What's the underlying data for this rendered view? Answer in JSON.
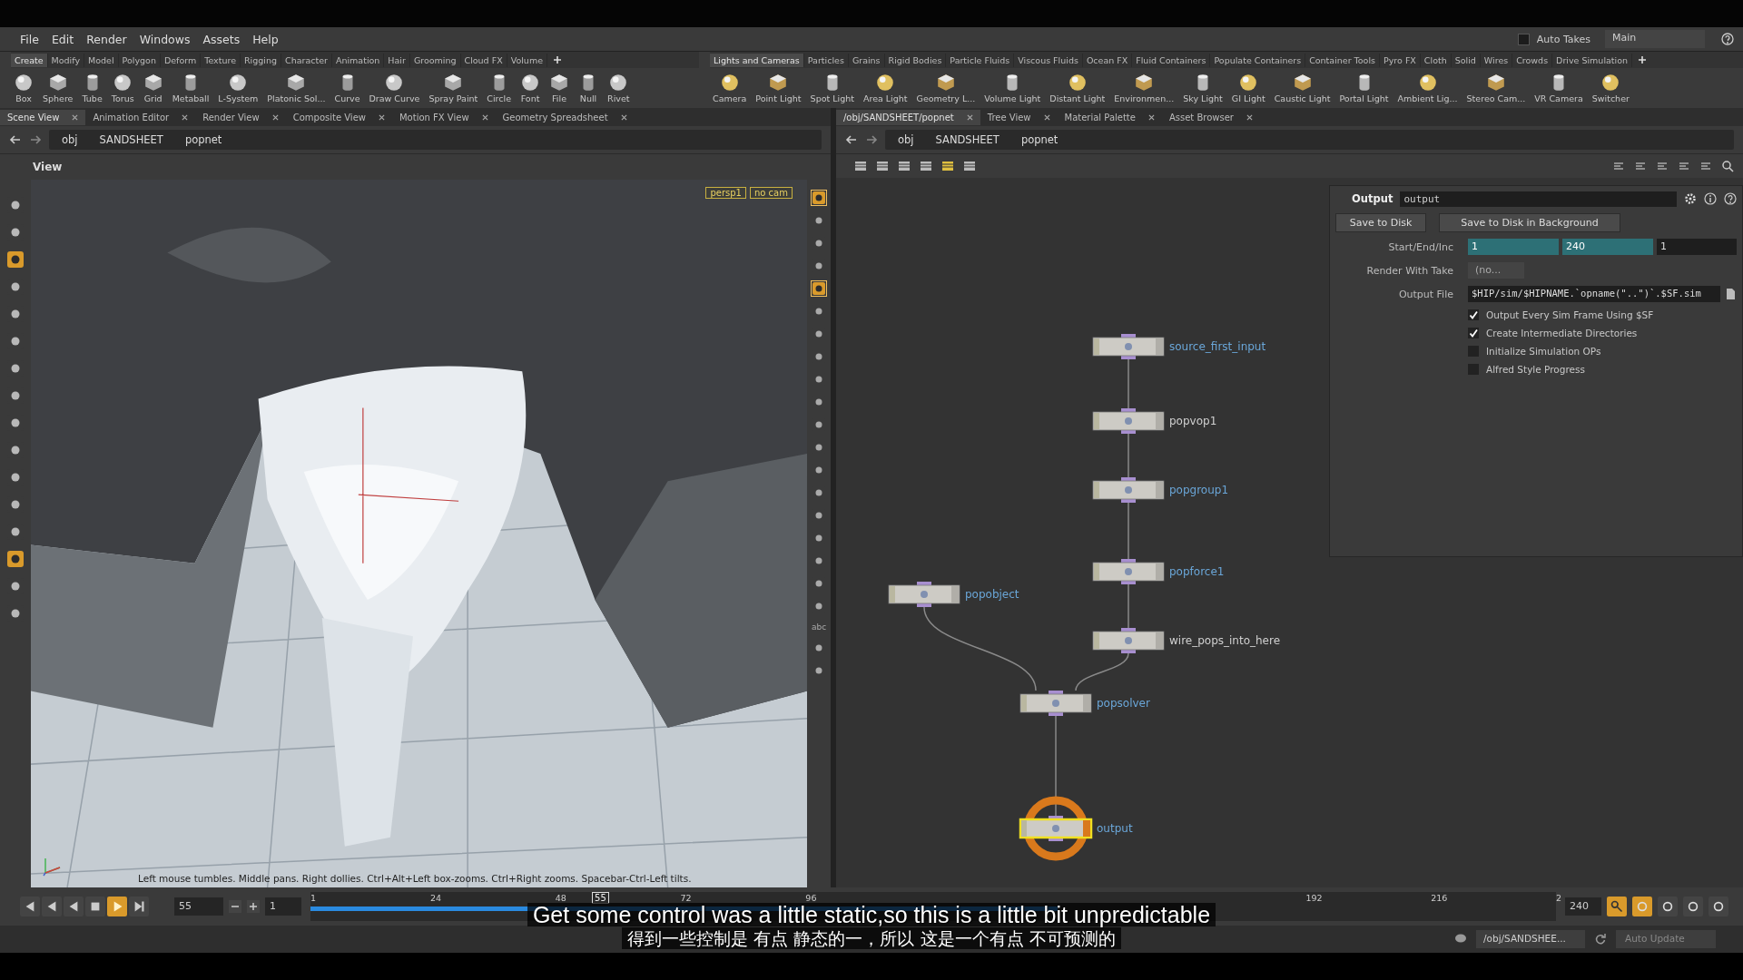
{
  "menu": [
    "File",
    "Edit",
    "Render",
    "Windows",
    "Assets",
    "Help"
  ],
  "takes": {
    "label": "Auto Takes",
    "checked": false,
    "take": "Main"
  },
  "shelves": [
    {
      "tabs": [
        {
          "label": "Create",
          "selected": true
        },
        {
          "label": "Modify",
          "selected": false
        },
        {
          "label": "Model",
          "selected": false
        },
        {
          "label": "Polygon",
          "selected": false
        },
        {
          "label": "Deform",
          "selected": false
        },
        {
          "label": "Texture",
          "selected": false
        },
        {
          "label": "Rigging",
          "selected": false
        },
        {
          "label": "Character",
          "selected": false
        },
        {
          "label": "Animation",
          "selected": false
        },
        {
          "label": "Hair",
          "selected": false
        },
        {
          "label": "Grooming",
          "selected": false
        },
        {
          "label": "Cloud FX",
          "selected": false
        },
        {
          "label": "Volume",
          "selected": false
        }
      ],
      "tools": [
        "Box",
        "Sphere",
        "Tube",
        "Torus",
        "Grid",
        "Metaball",
        "L-System",
        "Platonic Sol...",
        "Curve",
        "Draw Curve",
        "Spray Paint",
        "Circle",
        "Font",
        "File",
        "Null",
        "Rivet"
      ]
    },
    {
      "tabs": [
        {
          "label": "Lights and Cameras",
          "selected": true
        },
        {
          "label": "Particles",
          "selected": false
        },
        {
          "label": "Grains",
          "selected": false
        },
        {
          "label": "Rigid Bodies",
          "selected": false
        },
        {
          "label": "Particle Fluids",
          "selected": false
        },
        {
          "label": "Viscous Fluids",
          "selected": false
        },
        {
          "label": "Ocean FX",
          "selected": false
        },
        {
          "label": "Fluid Containers",
          "selected": false
        },
        {
          "label": "Populate Containers",
          "selected": false
        },
        {
          "label": "Container Tools",
          "selected": false
        },
        {
          "label": "Pyro FX",
          "selected": false
        },
        {
          "label": "Cloth",
          "selected": false
        },
        {
          "label": "Solid",
          "selected": false
        },
        {
          "label": "Wires",
          "selected": false
        },
        {
          "label": "Crowds",
          "selected": false
        },
        {
          "label": "Drive Simulation",
          "selected": false
        }
      ],
      "tools": [
        "Camera",
        "Point Light",
        "Spot Light",
        "Area Light",
        "Geometry L...",
        "Volume Light",
        "Distant Light",
        "Environmen...",
        "Sky Light",
        "GI Light",
        "Caustic Light",
        "Portal Light",
        "Ambient Lig...",
        "Stereo Cam...",
        "VR Camera",
        "Switcher"
      ]
    }
  ],
  "scene_pane": {
    "tabs": [
      {
        "label": "Scene View",
        "selected": true
      },
      {
        "label": "Animation Editor",
        "selected": false
      },
      {
        "label": "Render View",
        "selected": false
      },
      {
        "label": "Composite View",
        "selected": false
      },
      {
        "label": "Motion FX View",
        "selected": false
      },
      {
        "label": "Geometry Spreadsheet",
        "selected": false
      }
    ],
    "path": [
      "obj",
      "SANDSHEET",
      "popnet"
    ],
    "title": "View",
    "camera_menus": [
      "persp1",
      "no cam"
    ],
    "hint": "Left mouse tumbles. Middle pans. Right dollies. Ctrl+Alt+Left box-zooms. Ctrl+Right zooms. Spacebar-Ctrl-Left tilts.",
    "left_tools": [
      {
        "selected": false
      },
      {
        "selected": false
      },
      {
        "selected": true
      },
      {
        "selected": false
      },
      {
        "selected": false
      },
      {
        "selected": false
      },
      {
        "selected": false
      },
      {
        "selected": false
      },
      {
        "selected": false
      },
      {
        "selected": false
      },
      {
        "selected": false
      },
      {
        "selected": false
      },
      {
        "selected": false
      },
      {
        "selected": true
      },
      {
        "selected": false
      },
      {
        "selected": false
      }
    ],
    "right_tools": [
      {
        "kind": "icon",
        "selected": true
      },
      {
        "kind": "icon",
        "selected": false
      },
      {
        "kind": "icon",
        "selected": false
      },
      {
        "kind": "icon",
        "selected": false
      },
      {
        "kind": "icon",
        "selected": true
      },
      {
        "kind": "icon",
        "selected": false
      },
      {
        "kind": "icon",
        "selected": false
      },
      {
        "kind": "icon",
        "selected": false
      },
      {
        "kind": "icon",
        "selected": false
      },
      {
        "kind": "icon",
        "selected": false
      },
      {
        "kind": "icon",
        "selected": false
      },
      {
        "kind": "icon",
        "selected": false
      },
      {
        "kind": "icon",
        "selected": false
      },
      {
        "kind": "icon",
        "selected": false
      },
      {
        "kind": "icon",
        "selected": false
      },
      {
        "kind": "icon",
        "selected": false
      },
      {
        "kind": "icon",
        "selected": false
      },
      {
        "kind": "icon",
        "selected": false
      },
      {
        "kind": "icon",
        "selected": false
      },
      {
        "kind": "text",
        "label": "abc",
        "selected": false
      },
      {
        "kind": "icon",
        "selected": false
      },
      {
        "kind": "icon",
        "selected": false
      }
    ]
  },
  "network_pane": {
    "tabs": [
      {
        "label": "/obj/SANDSHEET/popnet",
        "selected": true
      },
      {
        "label": "Tree View",
        "selected": false
      },
      {
        "label": "Material Palette",
        "selected": false
      },
      {
        "label": "Asset Browser",
        "selected": false
      }
    ],
    "path": [
      "obj",
      "SANDSHEET",
      "popnet"
    ],
    "nodes": [
      {
        "name": "source_first_input",
        "color": "#6aa6d8",
        "selected": false,
        "flagged": false
      },
      {
        "name": "popvop1",
        "color": "#d0d0d0",
        "selected": false,
        "flagged": false
      },
      {
        "name": "popgroup1",
        "color": "#6aa6d8",
        "selected": false,
        "flagged": false
      },
      {
        "name": "popforce1",
        "color": "#6aa6d8",
        "selected": false,
        "flagged": false
      },
      {
        "name": "wire_pops_into_here",
        "color": "#d0d0d0",
        "selected": false,
        "flagged": false
      },
      {
        "name": "popobject",
        "color": "#6aa6d8",
        "selected": false,
        "flagged": false
      },
      {
        "name": "popsolver",
        "color": "#6aa6d8",
        "selected": false,
        "flagged": false
      },
      {
        "name": "output",
        "color": "#6aa6d8",
        "selected": true,
        "flagged": true
      }
    ]
  },
  "parameters": {
    "type": "Output",
    "name": "output",
    "buttons": [
      "Save to Disk",
      "Save to Disk in Background"
    ],
    "range_label": "Start/End/Inc",
    "range": [
      {
        "value": "1",
        "animated": true
      },
      {
        "value": "240",
        "animated": true
      },
      {
        "value": "1",
        "animated": false
      }
    ],
    "take_label": "Render With Take",
    "take": "(no...",
    "file_label": "Output File",
    "file": "$HIP/sim/$HIPNAME.`opname(\"..\")`.$SF.sim",
    "options": [
      {
        "label": "Output Every Sim Frame Using $SF",
        "checked": true
      },
      {
        "label": "Create Intermediate Directories",
        "checked": true
      },
      {
        "label": "Initialize Simulation OPs",
        "checked": false
      },
      {
        "label": "Alfred Style Progress",
        "checked": false
      }
    ]
  },
  "timeline": {
    "frame": "55",
    "start": "1",
    "end": "240",
    "playing": true,
    "playhead": {
      "label": "55",
      "level": 0.226
    },
    "cache": {
      "level": 0.6
    },
    "ruler_labels": [
      "1",
      "24",
      "48",
      "72",
      "96",
      "192",
      "216",
      "2"
    ]
  },
  "status": {
    "path": "/obj/SANDSHEE...",
    "update": "Auto Update"
  },
  "subtitles": {
    "english": "Get some control was a little static,so this is a little bit unpredictable",
    "chinese": "得到一些控制是 有点 静态的一，所以 这是一个有点 不可预测的"
  }
}
